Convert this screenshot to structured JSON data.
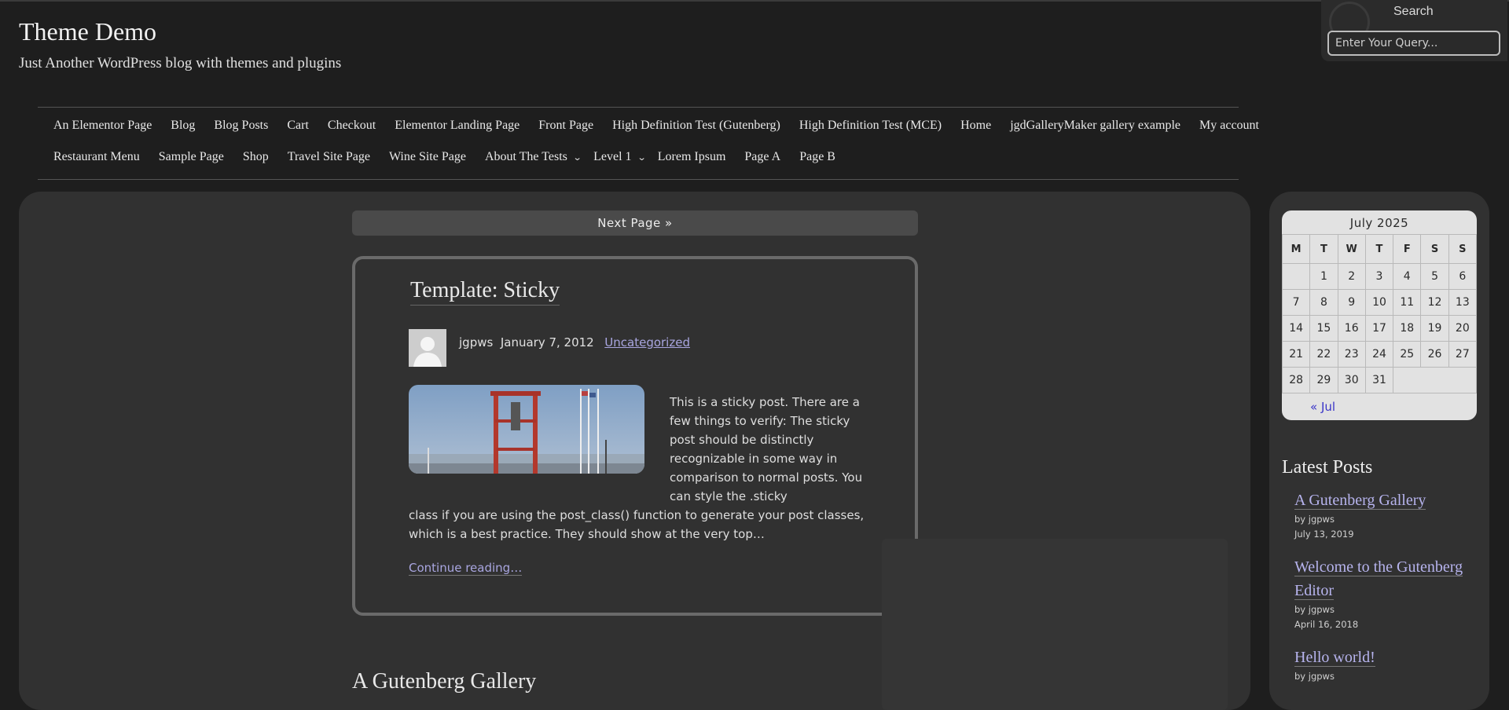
{
  "site": {
    "title": "Theme Demo",
    "tagline": "Just Another WordPress blog with themes and plugins"
  },
  "search": {
    "label": "Search",
    "placeholder": "Enter Your Query..."
  },
  "nav": {
    "row1": [
      "An Elementor Page",
      "Blog",
      "Blog Posts",
      "Cart",
      "Checkout",
      "Elementor Landing Page",
      "Front Page",
      "High Definition Test (Gutenberg)",
      "High Definition Test (MCE)",
      "Home",
      "jgdGalleryMaker gallery example",
      "My account"
    ],
    "row2": [
      "Restaurant Menu",
      "Sample Page",
      "Shop",
      "Travel Site Page",
      "Wine Site Page",
      "About The Tests",
      "Level 1",
      "Lorem Ipsum",
      "Page A",
      "Page B"
    ]
  },
  "pagination": {
    "next_label": "Next Page  »"
  },
  "post": {
    "title": "Template: Sticky",
    "author": "jgpws",
    "date": "January 7, 2012",
    "category": "Uncategorized",
    "excerpt_side": "This is a sticky post. There are a few things to verify: The sticky post should be distinctly recognizable in some way in comparison to normal posts. You can style the .sticky",
    "excerpt_full": "class if you are using the post_class() function to generate your post classes, which is a best practice. They should show at the very top…",
    "continue_label": "Continue reading…"
  },
  "next_post": {
    "title": "A Gutenberg Gallery"
  },
  "calendar": {
    "caption": "July 2025",
    "weekdays": [
      "M",
      "T",
      "W",
      "T",
      "F",
      "S",
      "S"
    ],
    "weeks": [
      [
        "",
        "1",
        "2",
        "3",
        "4",
        "5",
        "6"
      ],
      [
        "7",
        "8",
        "9",
        "10",
        "11",
        "12",
        "13"
      ],
      [
        "14",
        "15",
        "16",
        "17",
        "18",
        "19",
        "20"
      ],
      [
        "21",
        "22",
        "23",
        "24",
        "25",
        "26",
        "27"
      ],
      [
        "28",
        "29",
        "30",
        "31",
        "",
        "",
        ""
      ]
    ],
    "prev_label": "« Jul"
  },
  "latest_posts": {
    "title": "Latest Posts",
    "items": [
      {
        "title": "A Gutenberg Gallery",
        "byline": "by jgpws",
        "date": "July 13, 2019"
      },
      {
        "title": "Welcome to the Gutenberg Editor",
        "byline": "by jgpws",
        "date": "April 16, 2018"
      },
      {
        "title": "Hello world!",
        "byline": "by jgpws",
        "date": ""
      }
    ]
  },
  "colors": {
    "background": "#1e1e1e",
    "panel": "#313131",
    "link": "#a9a6e0",
    "calendar_bg": "#e2e2e2",
    "calendar_link": "#3b36c8"
  }
}
